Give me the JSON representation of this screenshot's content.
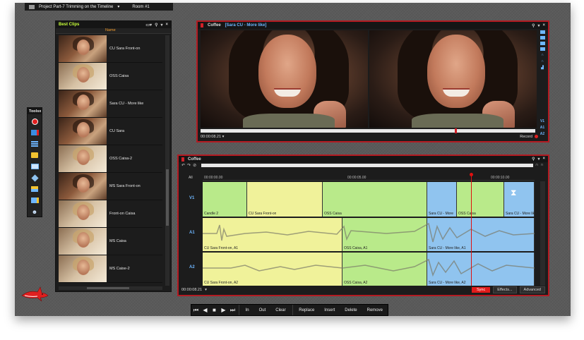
{
  "window": {
    "project_title": "Project Part-7 Trimming on the Timeline",
    "room": "Room #1"
  },
  "bins": {
    "title": "Best Clips",
    "name_header": "Name",
    "clips": [
      {
        "label": "CU Sara Front-on"
      },
      {
        "label": "OSS Caisa"
      },
      {
        "label": "Sara CU - More like"
      },
      {
        "label": "CU Sara"
      },
      {
        "label": "OSS Caisa-2"
      },
      {
        "label": "MS Sara Front-on"
      },
      {
        "label": "Front-on Caisa"
      },
      {
        "label": "MS Caisa"
      },
      {
        "label": "MS Caise-2"
      }
    ]
  },
  "tools": {
    "title": "Tools",
    "close": "x"
  },
  "monitor": {
    "title": "Coffee",
    "subtitle": "[Sara CU - More like]",
    "timecode": "00:00:08.21",
    "record_label": "Record",
    "side_tracks": [
      "V1",
      "A1",
      "A2"
    ]
  },
  "timeline": {
    "title": "Coffee",
    "all_label": "All",
    "ruler": [
      "00:00:00.00",
      "00:00:05.00",
      "00:00:10.00"
    ],
    "tracks": {
      "v1": {
        "label": "V1",
        "segments": [
          "Candle 2",
          "CU Sara Front-on",
          "OSS Caisa",
          "Sara CU - More",
          "OSS Caisa",
          "Sara CU - More like"
        ]
      },
      "a1": {
        "label": "A1",
        "segments": [
          "CU Sara Front-on, A1",
          "OSS Caisa, A1",
          "Sara CU - More like, A1"
        ]
      },
      "a2": {
        "label": "A2",
        "segments": [
          "CU Sara Front-on, A2",
          "OSS Caisa, A2",
          "Sara CU - More like, A2"
        ]
      }
    },
    "timecode": "00:00:08.21",
    "sync_label": "Sync",
    "effects_label": "Effects...",
    "advanced_label": "Advanced"
  },
  "transport": {
    "in": "In",
    "out": "Out",
    "clear": "Clear",
    "replace": "Replace",
    "insert": "Insert",
    "delete": "Delete",
    "remove": "Remove"
  },
  "colors": {
    "panel_red": "#b31b22",
    "bins_title": "#c8ff3a",
    "accent_blue": "#6eb6ff",
    "clip_yellow": "#f0f29a",
    "clip_green": "#b9ea8a",
    "clip_blue": "#90c4ef"
  }
}
